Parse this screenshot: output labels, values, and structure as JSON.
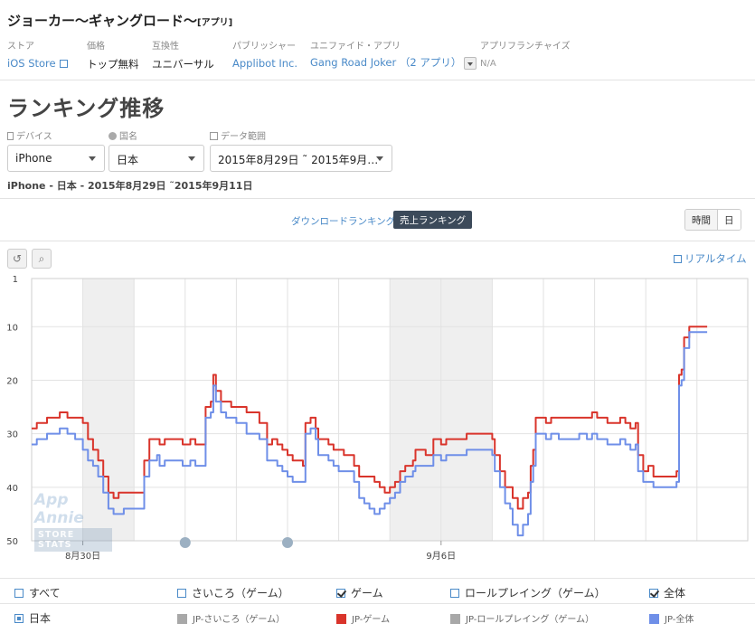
{
  "app": {
    "title": "ジョーカー～ギャングロード～",
    "title_suffix": "[アプリ]"
  },
  "meta": [
    {
      "label": "ストア",
      "value": "iOS Store",
      "link": true
    },
    {
      "label": "価格",
      "value": "トップ無料",
      "link": false
    },
    {
      "label": "互換性",
      "value": "ユニバーサル",
      "link": false
    },
    {
      "label": "パブリッシャー",
      "value": "Applibot Inc.",
      "link": true
    },
    {
      "label": "ユニファイド・アプリ",
      "value": "Gang Road Joker （2 アプリ）",
      "link": true
    },
    {
      "label": "アプリフランチャイズ",
      "value": "N/A",
      "link": false
    }
  ],
  "section_title": "ランキング推移",
  "filters": {
    "device": {
      "label": "デバイス",
      "value": "iPhone"
    },
    "country": {
      "label": "国名",
      "value": "日本"
    },
    "date": {
      "label": "データ範囲",
      "value": "2015年8月29日 ˜ 2015年9月…"
    }
  },
  "summary": "iPhone - 日本 - 2015年8月29日 ˜2015年9月11日",
  "ranking_toggle": {
    "download": "ダウンロードランキング",
    "revenue": "売上ランキング"
  },
  "granularity": {
    "hour": "時間",
    "day": "日"
  },
  "realtime_label": "リアルタイム",
  "watermark": {
    "top": "App Annie",
    "bottom": "STORE STATS"
  },
  "legend": {
    "categories": [
      {
        "label": "すべて",
        "checked": false
      },
      {
        "label": "さいころ（ゲーム）",
        "checked": false
      },
      {
        "label": "ゲーム",
        "checked": true
      },
      {
        "label": "ロールプレイング（ゲーム）",
        "checked": false
      },
      {
        "label": "全体",
        "checked": true
      }
    ],
    "country": "日本",
    "series": [
      {
        "label": "JP-さいころ（ゲーム）",
        "color": "#a8a8a8"
      },
      {
        "label": "JP-ゲーム",
        "color": "#d9342b"
      },
      {
        "label": "JP-ロールプレイング（ゲーム）",
        "color": "#a8a8a8"
      },
      {
        "label": "JP-全体",
        "color": "#6f8fe8"
      }
    ]
  },
  "chart_data": {
    "type": "line",
    "y_reversed": true,
    "ylim": [
      1,
      50
    ],
    "yticks": [
      1,
      10,
      20,
      30,
      40,
      50
    ],
    "x_range": [
      0,
      13.2
    ],
    "xticks": [
      {
        "x": 1,
        "label": "8月30日"
      },
      {
        "x": 8,
        "label": "9月6日"
      }
    ],
    "weekend_bands": [
      [
        1,
        2
      ],
      [
        7,
        9
      ]
    ],
    "grid": true,
    "series": [
      {
        "name": "JP-ゲーム",
        "color": "#d9342b",
        "points": [
          [
            0,
            29
          ],
          [
            0.1,
            28
          ],
          [
            0.2,
            28
          ],
          [
            0.3,
            27
          ],
          [
            0.45,
            27
          ],
          [
            0.55,
            26
          ],
          [
            0.7,
            27
          ],
          [
            0.85,
            27
          ],
          [
            1,
            28
          ],
          [
            1.1,
            31
          ],
          [
            1.2,
            33
          ],
          [
            1.3,
            35
          ],
          [
            1.4,
            38
          ],
          [
            1.5,
            41
          ],
          [
            1.6,
            42
          ],
          [
            1.7,
            41
          ],
          [
            1.8,
            41
          ],
          [
            2.0,
            41
          ],
          [
            2.15,
            41
          ],
          [
            2.2,
            35
          ],
          [
            2.3,
            31
          ],
          [
            2.45,
            31
          ],
          [
            2.5,
            32
          ],
          [
            2.6,
            31
          ],
          [
            2.75,
            31
          ],
          [
            2.85,
            31
          ],
          [
            2.95,
            32
          ],
          [
            3.1,
            31
          ],
          [
            3.2,
            32
          ],
          [
            3.3,
            32
          ],
          [
            3.4,
            25
          ],
          [
            3.5,
            24
          ],
          [
            3.55,
            19
          ],
          [
            3.6,
            22
          ],
          [
            3.7,
            24
          ],
          [
            3.8,
            24
          ],
          [
            3.9,
            25
          ],
          [
            4.0,
            25
          ],
          [
            4.1,
            25
          ],
          [
            4.2,
            26
          ],
          [
            4.3,
            26
          ],
          [
            4.45,
            28
          ],
          [
            4.55,
            28
          ],
          [
            4.6,
            32
          ],
          [
            4.7,
            31
          ],
          [
            4.8,
            32
          ],
          [
            4.9,
            33
          ],
          [
            5.0,
            34
          ],
          [
            5.1,
            35
          ],
          [
            5.2,
            35
          ],
          [
            5.3,
            36
          ],
          [
            5.35,
            28
          ],
          [
            5.45,
            27
          ],
          [
            5.5,
            27
          ],
          [
            5.55,
            29
          ],
          [
            5.6,
            31
          ],
          [
            5.7,
            31
          ],
          [
            5.8,
            32
          ],
          [
            5.9,
            33
          ],
          [
            6.0,
            33
          ],
          [
            6.1,
            34
          ],
          [
            6.2,
            34
          ],
          [
            6.3,
            36
          ],
          [
            6.4,
            38
          ],
          [
            6.5,
            38
          ],
          [
            6.6,
            38
          ],
          [
            6.7,
            39
          ],
          [
            6.8,
            40
          ],
          [
            6.9,
            41
          ],
          [
            7.0,
            40
          ],
          [
            7.1,
            39
          ],
          [
            7.2,
            37
          ],
          [
            7.3,
            36
          ],
          [
            7.45,
            35
          ],
          [
            7.5,
            33
          ],
          [
            7.6,
            33
          ],
          [
            7.7,
            34
          ],
          [
            7.8,
            34
          ],
          [
            7.85,
            31
          ],
          [
            7.95,
            31
          ],
          [
            8.0,
            32
          ],
          [
            8.1,
            31
          ],
          [
            8.25,
            31
          ],
          [
            8.4,
            31
          ],
          [
            8.5,
            30
          ],
          [
            8.6,
            30
          ],
          [
            8.75,
            30
          ],
          [
            8.9,
            30
          ],
          [
            9.0,
            31
          ],
          [
            9.05,
            34
          ],
          [
            9.15,
            37
          ],
          [
            9.25,
            40
          ],
          [
            9.35,
            40
          ],
          [
            9.4,
            42
          ],
          [
            9.5,
            44
          ],
          [
            9.6,
            42
          ],
          [
            9.7,
            41
          ],
          [
            9.75,
            36
          ],
          [
            9.8,
            33
          ],
          [
            9.85,
            27
          ],
          [
            9.95,
            27
          ],
          [
            10.05,
            28
          ],
          [
            10.15,
            27
          ],
          [
            10.3,
            27
          ],
          [
            10.5,
            27
          ],
          [
            10.7,
            27
          ],
          [
            10.85,
            27
          ],
          [
            10.95,
            26
          ],
          [
            11.05,
            27
          ],
          [
            11.15,
            27
          ],
          [
            11.25,
            28
          ],
          [
            11.4,
            28
          ],
          [
            11.5,
            27
          ],
          [
            11.6,
            28
          ],
          [
            11.7,
            29
          ],
          [
            11.8,
            28
          ],
          [
            11.85,
            34
          ],
          [
            11.95,
            37
          ],
          [
            12.05,
            36
          ],
          [
            12.15,
            38
          ],
          [
            12.3,
            38
          ],
          [
            12.5,
            38
          ],
          [
            12.6,
            37
          ],
          [
            12.65,
            19
          ],
          [
            12.7,
            18
          ],
          [
            12.75,
            12
          ],
          [
            12.85,
            10
          ],
          [
            13.0,
            10
          ],
          [
            13.2,
            10
          ]
        ]
      },
      {
        "name": "JP-全体",
        "color": "#6f8fe8",
        "points": [
          [
            0,
            32
          ],
          [
            0.1,
            31
          ],
          [
            0.2,
            31
          ],
          [
            0.3,
            30
          ],
          [
            0.45,
            30
          ],
          [
            0.55,
            29
          ],
          [
            0.7,
            30
          ],
          [
            0.85,
            31
          ],
          [
            1,
            33
          ],
          [
            1.1,
            35
          ],
          [
            1.2,
            36
          ],
          [
            1.3,
            38
          ],
          [
            1.4,
            41
          ],
          [
            1.5,
            44
          ],
          [
            1.6,
            45
          ],
          [
            1.7,
            45
          ],
          [
            1.8,
            44
          ],
          [
            2.0,
            44
          ],
          [
            2.15,
            44
          ],
          [
            2.2,
            38
          ],
          [
            2.3,
            35
          ],
          [
            2.45,
            34
          ],
          [
            2.5,
            36
          ],
          [
            2.6,
            35
          ],
          [
            2.75,
            35
          ],
          [
            2.85,
            35
          ],
          [
            2.95,
            36
          ],
          [
            3.1,
            35
          ],
          [
            3.2,
            36
          ],
          [
            3.3,
            36
          ],
          [
            3.4,
            27
          ],
          [
            3.5,
            26
          ],
          [
            3.55,
            21
          ],
          [
            3.6,
            24
          ],
          [
            3.7,
            26
          ],
          [
            3.8,
            27
          ],
          [
            3.9,
            27
          ],
          [
            4.0,
            28
          ],
          [
            4.1,
            28
          ],
          [
            4.2,
            30
          ],
          [
            4.3,
            30
          ],
          [
            4.45,
            31
          ],
          [
            4.55,
            31
          ],
          [
            4.6,
            35
          ],
          [
            4.7,
            35
          ],
          [
            4.8,
            36
          ],
          [
            4.9,
            37
          ],
          [
            5.0,
            38
          ],
          [
            5.1,
            39
          ],
          [
            5.2,
            39
          ],
          [
            5.3,
            39
          ],
          [
            5.35,
            30
          ],
          [
            5.45,
            29
          ],
          [
            5.5,
            29
          ],
          [
            5.55,
            31
          ],
          [
            5.6,
            34
          ],
          [
            5.7,
            34
          ],
          [
            5.8,
            35
          ],
          [
            5.9,
            36
          ],
          [
            6.0,
            37
          ],
          [
            6.1,
            37
          ],
          [
            6.2,
            37
          ],
          [
            6.3,
            39
          ],
          [
            6.4,
            42
          ],
          [
            6.5,
            43
          ],
          [
            6.6,
            44
          ],
          [
            6.7,
            45
          ],
          [
            6.8,
            44
          ],
          [
            6.9,
            43
          ],
          [
            7.0,
            42
          ],
          [
            7.1,
            41
          ],
          [
            7.2,
            39
          ],
          [
            7.3,
            38
          ],
          [
            7.45,
            37
          ],
          [
            7.5,
            36
          ],
          [
            7.6,
            36
          ],
          [
            7.7,
            36
          ],
          [
            7.8,
            36
          ],
          [
            7.85,
            34
          ],
          [
            7.95,
            34
          ],
          [
            8.0,
            35
          ],
          [
            8.1,
            34
          ],
          [
            8.25,
            34
          ],
          [
            8.4,
            34
          ],
          [
            8.5,
            33
          ],
          [
            8.6,
            33
          ],
          [
            8.75,
            33
          ],
          [
            8.9,
            33
          ],
          [
            9.0,
            34
          ],
          [
            9.05,
            37
          ],
          [
            9.15,
            40
          ],
          [
            9.25,
            43
          ],
          [
            9.35,
            44
          ],
          [
            9.4,
            47
          ],
          [
            9.5,
            49
          ],
          [
            9.6,
            47
          ],
          [
            9.7,
            45
          ],
          [
            9.75,
            39
          ],
          [
            9.8,
            36
          ],
          [
            9.85,
            30
          ],
          [
            9.95,
            30
          ],
          [
            10.05,
            31
          ],
          [
            10.15,
            30
          ],
          [
            10.3,
            31
          ],
          [
            10.5,
            31
          ],
          [
            10.7,
            30
          ],
          [
            10.85,
            31
          ],
          [
            10.95,
            30
          ],
          [
            11.05,
            31
          ],
          [
            11.15,
            31
          ],
          [
            11.25,
            32
          ],
          [
            11.4,
            32
          ],
          [
            11.5,
            31
          ],
          [
            11.6,
            32
          ],
          [
            11.7,
            33
          ],
          [
            11.8,
            32
          ],
          [
            11.85,
            37
          ],
          [
            11.95,
            39
          ],
          [
            12.05,
            39
          ],
          [
            12.15,
            40
          ],
          [
            12.3,
            40
          ],
          [
            12.5,
            40
          ],
          [
            12.6,
            39
          ],
          [
            12.65,
            21
          ],
          [
            12.7,
            20
          ],
          [
            12.75,
            14
          ],
          [
            12.85,
            11
          ],
          [
            13.0,
            11
          ],
          [
            13.2,
            11
          ]
        ]
      }
    ]
  }
}
